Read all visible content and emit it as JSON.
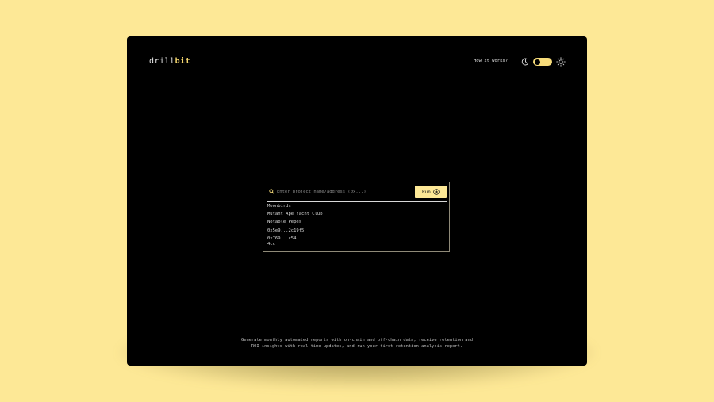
{
  "app": {
    "logo_prefix": "drill",
    "logo_accent": "bit"
  },
  "header": {
    "how_it_works_label": "How it works?",
    "theme_icons": [
      "moon-icon",
      "sun-icon"
    ],
    "toggle_state": "dark"
  },
  "search": {
    "placeholder": "Enter project name/address (0x...)",
    "value": "",
    "run_label": "Run",
    "suggestions": [
      "Moonbirds",
      "Mutant Ape Yacht Club",
      "Notable Pepes",
      "0x5e9...2c19f5",
      "0x769...c54 4cc"
    ]
  },
  "footer": {
    "line1": "Generate monthly automated reports with on-chain and off-chain data, receive retention and",
    "line2": "ROI insights with real-time updates, and run your first retention analysis report."
  },
  "colors": {
    "page_background": "#fde896",
    "window_background": "#000000",
    "accent": "#f7dc7a",
    "text": "#e8e8e8"
  }
}
